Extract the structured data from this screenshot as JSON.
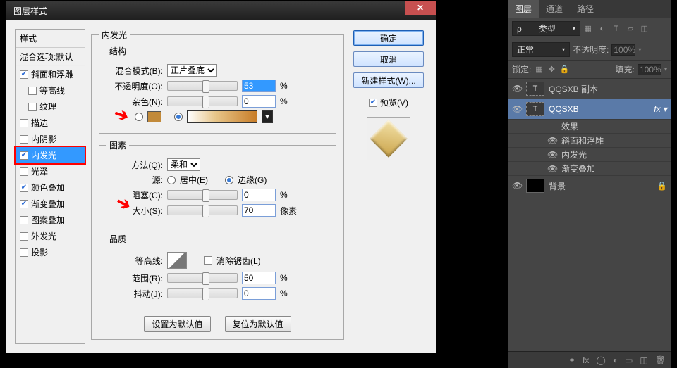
{
  "dialog": {
    "title": "图层样式",
    "styles_header": "样式",
    "blend_options": "混合选项:默认",
    "items": [
      {
        "label": "斜面和浮雕",
        "checked": true,
        "indent": false
      },
      {
        "label": "等高线",
        "checked": false,
        "indent": true
      },
      {
        "label": "纹理",
        "checked": false,
        "indent": true
      },
      {
        "label": "描边",
        "checked": false,
        "indent": false
      },
      {
        "label": "内阴影",
        "checked": false,
        "indent": false
      },
      {
        "label": "内发光",
        "checked": true,
        "indent": false,
        "selected": true
      },
      {
        "label": "光泽",
        "checked": false,
        "indent": false
      },
      {
        "label": "颜色叠加",
        "checked": true,
        "indent": false
      },
      {
        "label": "渐变叠加",
        "checked": true,
        "indent": false
      },
      {
        "label": "图案叠加",
        "checked": false,
        "indent": false
      },
      {
        "label": "外发光",
        "checked": false,
        "indent": false
      },
      {
        "label": "投影",
        "checked": false,
        "indent": false
      }
    ],
    "group_title": "内发光",
    "structure": {
      "legend": "结构",
      "blend_label": "混合模式(B):",
      "blend_value": "正片叠底",
      "opacity_label": "不透明度(O):",
      "opacity_value": "53",
      "opacity_unit": "%",
      "noise_label": "杂色(N):",
      "noise_value": "0",
      "noise_unit": "%"
    },
    "elements": {
      "legend": "图素",
      "method_label": "方法(Q):",
      "method_value": "柔和",
      "source_label": "源:",
      "source_center": "居中(E)",
      "source_edge": "边缘(G)",
      "choke_label": "阻塞(C):",
      "choke_value": "0",
      "choke_unit": "%",
      "size_label": "大小(S):",
      "size_value": "70",
      "size_unit": "像素"
    },
    "quality": {
      "legend": "品质",
      "contour_label": "等高线:",
      "antialias_label": "消除锯齿(L)",
      "range_label": "范围(R):",
      "range_value": "50",
      "range_unit": "%",
      "jitter_label": "抖动(J):",
      "jitter_value": "0",
      "jitter_unit": "%"
    },
    "buttons": {
      "default": "设置为默认值",
      "reset": "复位为默认值"
    },
    "right": {
      "ok": "确定",
      "cancel": "取消",
      "new": "新建样式(W)...",
      "preview": "预览(V)"
    }
  },
  "panel": {
    "tabs": {
      "layers": "图层",
      "channels": "通道",
      "paths": "路径"
    },
    "kind_label": "类型",
    "blend": "正常",
    "opacity_label": "不透明度:",
    "opacity": "100%",
    "lock_label": "锁定:",
    "fill_label": "填充:",
    "fill": "100%",
    "layers": [
      {
        "name": "QQSXB 副本",
        "type": "T"
      },
      {
        "name": "QQSXB",
        "type": "T",
        "selected": true,
        "fx": true
      },
      {
        "name": "效果",
        "child": true
      },
      {
        "name": "斜面和浮雕",
        "child": true,
        "eye": true
      },
      {
        "name": "内发光",
        "child": true,
        "eye": true
      },
      {
        "name": "渐变叠加",
        "child": true,
        "eye": true
      },
      {
        "name": "背景",
        "type": "bg",
        "locked": true
      }
    ]
  }
}
